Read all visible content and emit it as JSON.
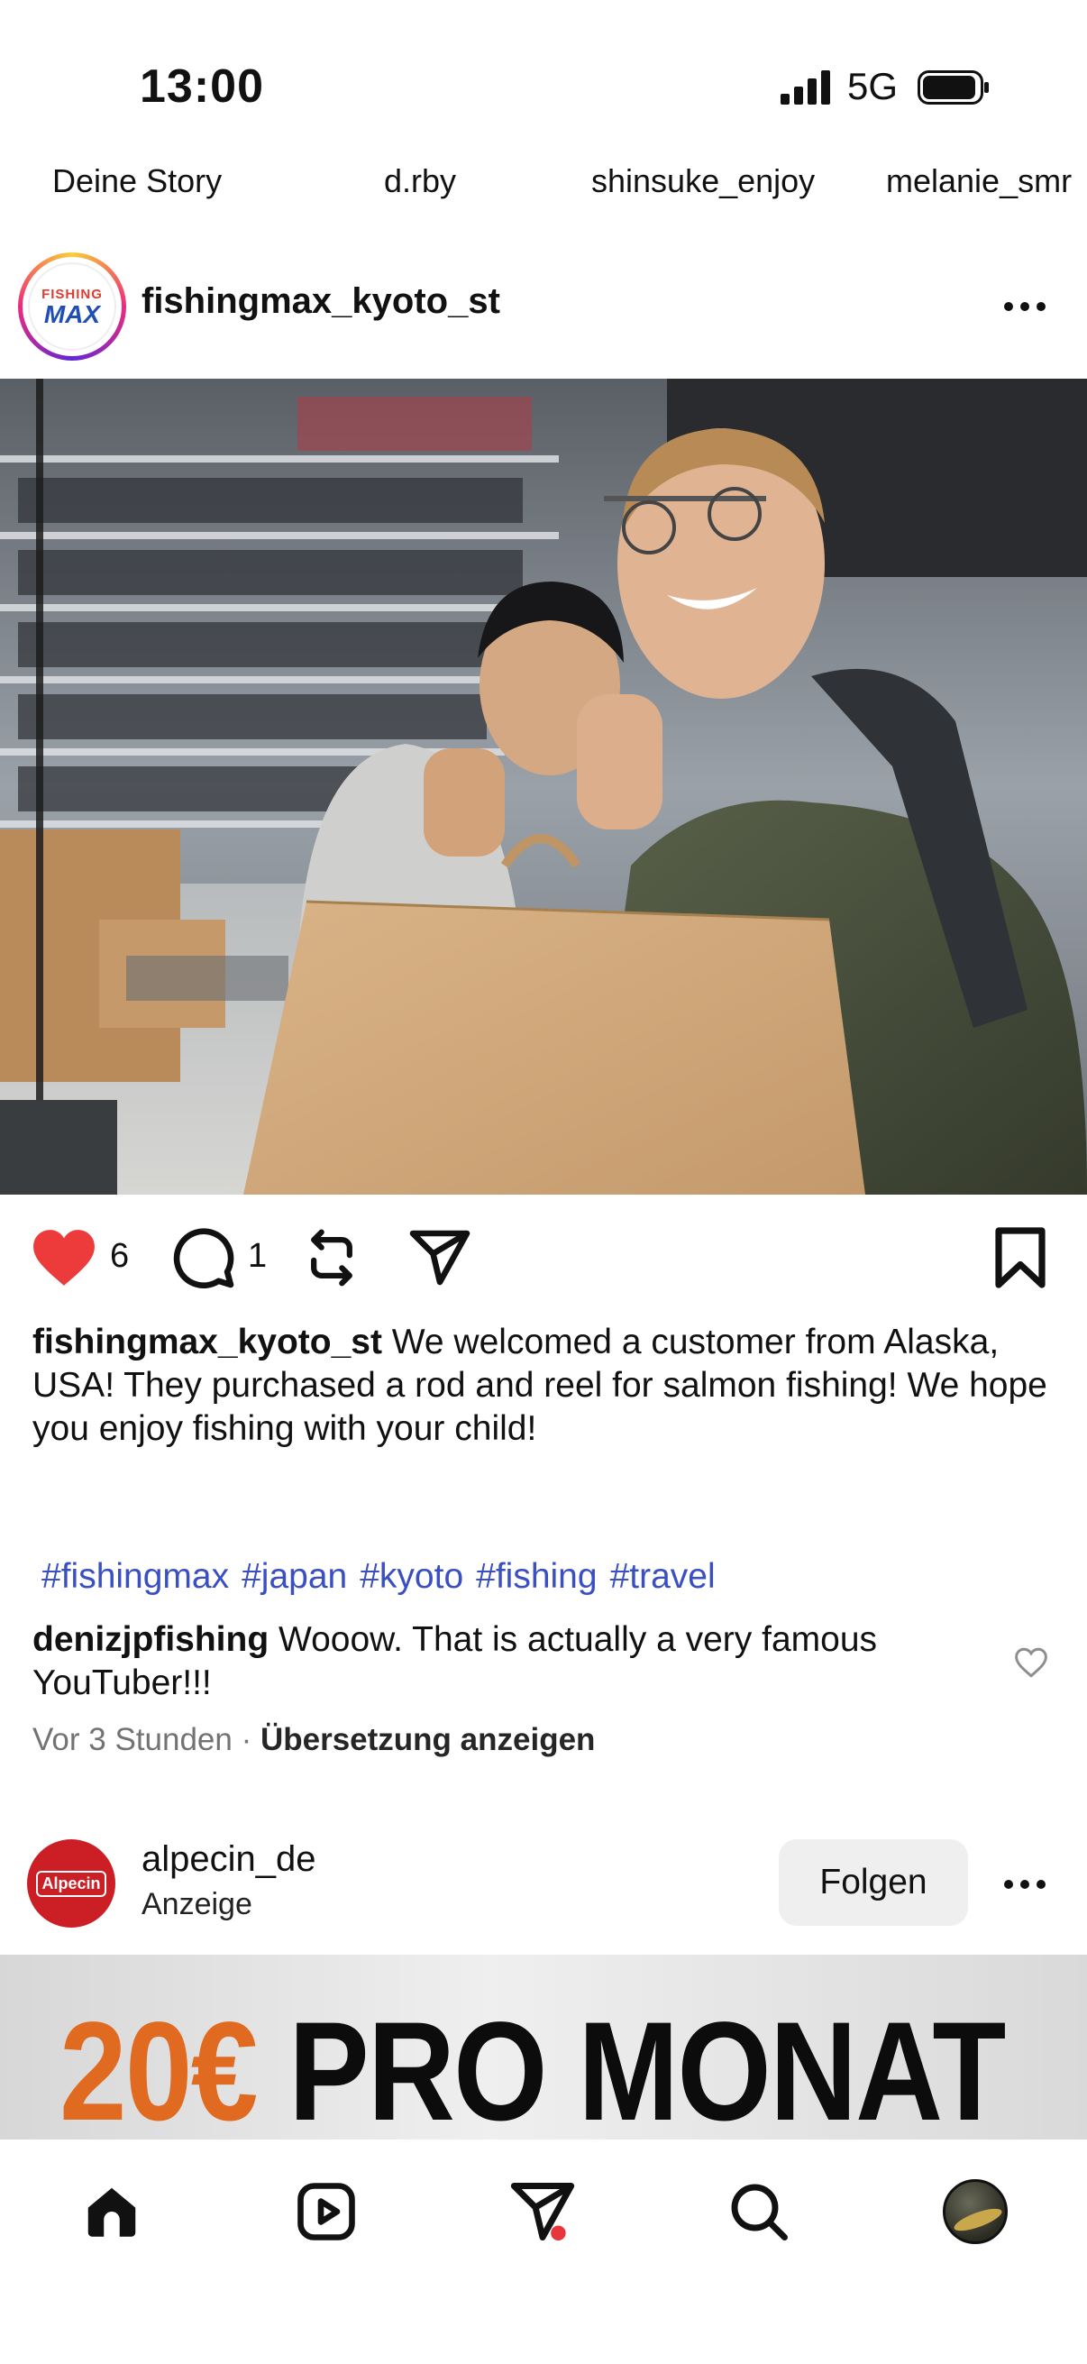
{
  "status_bar": {
    "time": "13:00",
    "network": "5G"
  },
  "stories": [
    "Deine Story",
    "d.rby",
    "shinsuke_enjoy",
    "melanie_smr"
  ],
  "post": {
    "username": "fishingmax_kyoto_st",
    "avatar_logo_top": "FISHING",
    "avatar_logo_bottom": "MAX",
    "likes": "6",
    "comments": "1",
    "caption_user": "fishingmax_kyoto_st",
    "caption_text": " We welcomed a customer from Alaska, USA! They purchased a rod and reel for salmon fishing! We hope you enjoy fishing with your child!",
    "hashtags": [
      "#fishingmax",
      "#japan",
      "#kyoto",
      "#fishing",
      "#travel"
    ],
    "comment_user": "denizjpfishing",
    "comment_text": " Wooow. That is actually a very famous YouTuber!!!",
    "time_ago": "Vor 3 Stunden",
    "translate_label": "Übersetzung anzeigen"
  },
  "ad": {
    "username": "alpecin_de",
    "subtitle": "Anzeige",
    "avatar_text": "Alpecin",
    "follow_label": "Folgen",
    "banner_price": "20€",
    "banner_rest": " PRO MONAT"
  },
  "colors": {
    "heart": "#ed3a3a",
    "hashtag": "#3a4fc4",
    "notification_dot": "#e8363d",
    "ad_price": "#e06a1f"
  },
  "icons": [
    "signal-icon",
    "battery-icon",
    "more-icon",
    "heart-icon",
    "comment-icon",
    "repost-icon",
    "share-icon",
    "bookmark-icon",
    "home-icon",
    "reels-icon",
    "messages-icon",
    "search-icon",
    "profile-avatar"
  ]
}
